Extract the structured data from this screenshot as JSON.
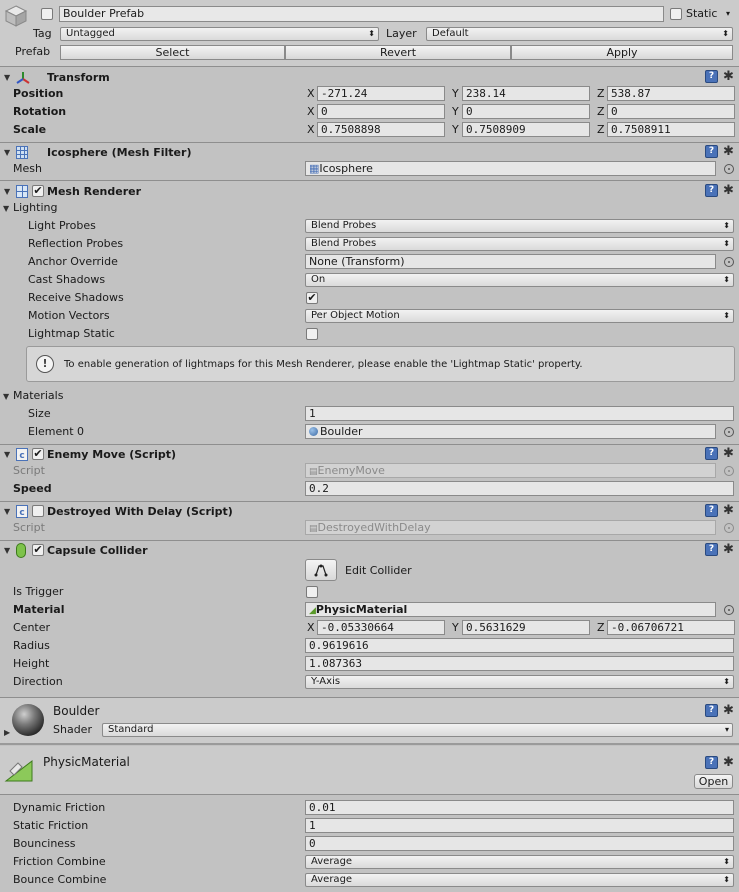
{
  "header": {
    "name": "Boulder Prefab",
    "static_label": "Static",
    "tag_label": "Tag",
    "tag_value": "Untagged",
    "layer_label": "Layer",
    "layer_value": "Default",
    "prefab_label": "Prefab",
    "select_label": "Select",
    "revert_label": "Revert",
    "apply_label": "Apply"
  },
  "transform": {
    "title": "Transform",
    "position_label": "Position",
    "rotation_label": "Rotation",
    "scale_label": "Scale",
    "axis_x": "X",
    "axis_y": "Y",
    "axis_z": "Z",
    "position": {
      "x": "-271.24",
      "y": "238.14",
      "z": "538.87"
    },
    "rotation": {
      "x": "0",
      "y": "0",
      "z": "0"
    },
    "scale": {
      "x": "0.7508898",
      "y": "0.7508909",
      "z": "0.7508911"
    }
  },
  "mesh_filter": {
    "title": "Icosphere (Mesh Filter)",
    "mesh_label": "Mesh",
    "mesh_value": "Icosphere"
  },
  "mesh_renderer": {
    "title": "Mesh Renderer",
    "lighting_label": "Lighting",
    "light_probes_label": "Light Probes",
    "light_probes_value": "Blend Probes",
    "reflection_probes_label": "Reflection Probes",
    "reflection_probes_value": "Blend Probes",
    "anchor_override_label": "Anchor Override",
    "anchor_override_value": "None (Transform)",
    "cast_shadows_label": "Cast Shadows",
    "cast_shadows_value": "On",
    "receive_shadows_label": "Receive Shadows",
    "motion_vectors_label": "Motion Vectors",
    "motion_vectors_value": "Per Object Motion",
    "lightmap_static_label": "Lightmap Static",
    "info_message": "To enable generation of lightmaps for this Mesh Renderer, please enable the 'Lightmap Static' property.",
    "materials_label": "Materials",
    "size_label": "Size",
    "size_value": "1",
    "element0_label": "Element 0",
    "element0_value": "Boulder"
  },
  "enemy_move": {
    "title": "Enemy Move (Script)",
    "script_label": "Script",
    "script_value": "EnemyMove",
    "speed_label": "Speed",
    "speed_value": "0.2"
  },
  "destroyed_with_delay": {
    "title": "Destroyed With Delay (Script)",
    "script_label": "Script",
    "script_value": "DestroyedWithDelay"
  },
  "capsule_collider": {
    "title": "Capsule Collider",
    "edit_collider_label": "Edit Collider",
    "is_trigger_label": "Is Trigger",
    "material_label": "Material",
    "material_value": "PhysicMaterial",
    "center_label": "Center",
    "center": {
      "x": "-0.05330664",
      "y": "0.5631629",
      "z": "-0.06706721"
    },
    "radius_label": "Radius",
    "radius_value": "0.9619616",
    "height_label": "Height",
    "height_value": "1.087363",
    "direction_label": "Direction",
    "direction_value": "Y-Axis"
  },
  "material_boulder": {
    "title": "Boulder",
    "shader_label": "Shader",
    "shader_value": "Standard"
  },
  "physic_material": {
    "title": "PhysicMaterial",
    "open_label": "Open",
    "dynamic_friction_label": "Dynamic Friction",
    "dynamic_friction_value": "0.01",
    "static_friction_label": "Static Friction",
    "static_friction_value": "1",
    "bounciness_label": "Bounciness",
    "bounciness_value": "0",
    "friction_combine_label": "Friction Combine",
    "friction_combine_value": "Average",
    "bounce_combine_label": "Bounce Combine",
    "bounce_combine_value": "Average"
  },
  "icons": {
    "help": "help-icon",
    "gear": "gear-icon",
    "object_picker": "object-picker-icon",
    "foldout": "foldout-arrow-icon"
  },
  "colors": {
    "background": "#c2c2c2",
    "field": "#e6e6e6",
    "help_icon": "#4a72b8",
    "info_box": "#d6d6d6"
  }
}
